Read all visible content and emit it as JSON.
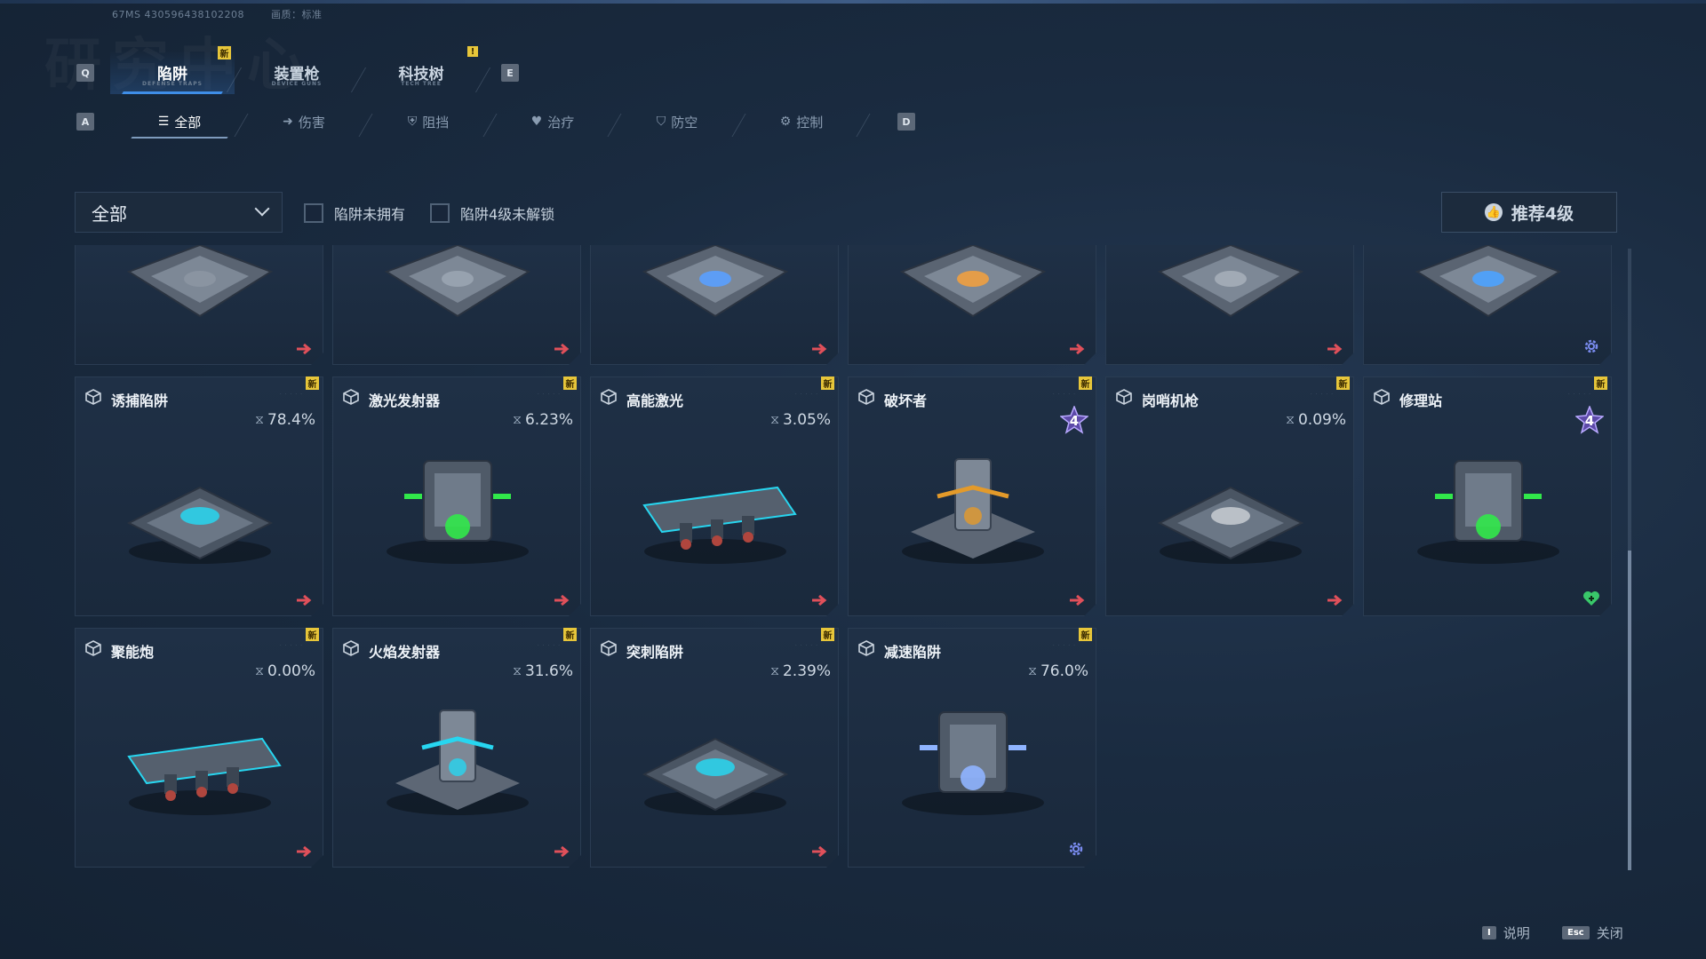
{
  "debug": {
    "fps_id": "67MS  430596438102208",
    "quality": "画质：标准"
  },
  "watermark": "研究中心",
  "keys": {
    "q": "Q",
    "e": "E",
    "a": "A",
    "d": "D"
  },
  "main_tabs": [
    {
      "label": "陷阱",
      "caption": "DEFENSE TRAPS",
      "active": true,
      "badge": "新"
    },
    {
      "label": "装置枪",
      "caption": "DEVICE GUNS",
      "active": false
    },
    {
      "label": "科技树",
      "caption": "TECH TREE",
      "active": false,
      "badge": "!"
    }
  ],
  "sub_tabs": [
    {
      "label": "全部",
      "icon": "list-icon",
      "active": true
    },
    {
      "label": "伤害",
      "icon": "arrow-right-icon",
      "active": false
    },
    {
      "label": "阻挡",
      "icon": "shield-icon",
      "active": false
    },
    {
      "label": "治疗",
      "icon": "heart-plus-icon",
      "active": false
    },
    {
      "label": "防空",
      "icon": "shield-plane-icon",
      "active": false
    },
    {
      "label": "控制",
      "icon": "gear-icon",
      "active": false
    }
  ],
  "filter": {
    "dropdown_value": "全部",
    "check_unowned": "陷阱未拥有",
    "check_lv4": "陷阱4级未解锁",
    "recommend_label": "推荐4级"
  },
  "top_row": [
    {
      "tint": "#8c96a2",
      "corner": "arrow"
    },
    {
      "tint": "#9aa5b1",
      "corner": "arrow"
    },
    {
      "tint": "#5aa0ff",
      "corner": "arrow"
    },
    {
      "tint": "#f0a040",
      "corner": "arrow"
    },
    {
      "tint": "#a5aeb8",
      "corner": "arrow"
    },
    {
      "tint": "#4da3ff",
      "corner": "gear"
    }
  ],
  "cards": [
    {
      "name": "诱捕陷阱",
      "new": "新",
      "pct": "78.4%",
      "accent": "#27d6f0",
      "corner": "arrow"
    },
    {
      "name": "激光发射器",
      "new": "新",
      "pct": "6.23%",
      "accent": "#31e84a",
      "corner": "arrow"
    },
    {
      "name": "高能激光",
      "new": "新",
      "pct": "3.05%",
      "accent": "#27d6f0",
      "corner": "arrow"
    },
    {
      "name": "破坏者",
      "new": "新",
      "pct": "",
      "level": "4",
      "accent": "#e39a2a",
      "corner": "arrow"
    },
    {
      "name": "岗哨机枪",
      "new": "新",
      "pct": "0.09%",
      "accent": "#c8ccd2",
      "corner": "arrow"
    },
    {
      "name": "修理站",
      "new": "新",
      "pct": "",
      "level": "4",
      "accent": "#31e84a",
      "corner": "heart"
    },
    {
      "name": "聚能炮",
      "new": "新",
      "pct": "0.00%",
      "accent": "#27d6f0",
      "corner": "arrow"
    },
    {
      "name": "火焰发射器",
      "new": "新",
      "pct": "31.6%",
      "accent": "#27d6f0",
      "corner": "arrow"
    },
    {
      "name": "突刺陷阱",
      "new": "新",
      "pct": "2.39%",
      "accent": "#27d6f0",
      "corner": "arrow"
    },
    {
      "name": "减速陷阱",
      "new": "新",
      "pct": "76.0%",
      "accent": "#8fb4ff",
      "corner": "gear"
    }
  ],
  "footer": {
    "help_key": "I",
    "help_label": "说明",
    "close_key": "Esc",
    "close_label": "关闭"
  },
  "colors": {
    "accent_blue": "#3f8ee8",
    "new_badge": "#e7c63a",
    "arrow_red": "#e0505a",
    "gear_blue": "#7a8cf0",
    "heart_green": "#39c86a"
  }
}
